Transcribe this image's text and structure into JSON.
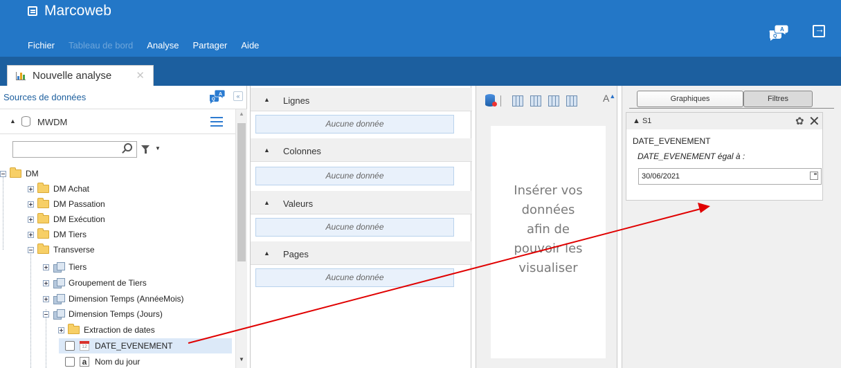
{
  "app": {
    "title": "Marcoweb",
    "menu": [
      {
        "label": "Fichier",
        "enabled": true
      },
      {
        "label": "Tableau de bord",
        "enabled": false
      },
      {
        "label": "Analyse",
        "enabled": true
      },
      {
        "label": "Partager",
        "enabled": true
      },
      {
        "label": "Aide",
        "enabled": true
      }
    ],
    "colors": {
      "header": "#2377c7",
      "tabstrip": "#1c5f9f",
      "annotation_arrow": "#e00000"
    }
  },
  "tab": {
    "label": "Nouvelle analyse",
    "close_icon": "close-icon"
  },
  "sources": {
    "title": "Sources de données",
    "datasource": "MWDM",
    "search": {
      "value": "",
      "placeholder": ""
    },
    "tree": [
      {
        "label": "DM",
        "depth": 0,
        "expander": "minus",
        "icon": "folder-icon"
      },
      {
        "label": "DM Achat",
        "depth": 1,
        "expander": "plus",
        "icon": "folder-icon"
      },
      {
        "label": "DM Passation",
        "depth": 1,
        "expander": "plus",
        "icon": "folder-icon"
      },
      {
        "label": "DM Exécution",
        "depth": 1,
        "expander": "plus",
        "icon": "folder-icon"
      },
      {
        "label": "DM Tiers",
        "depth": 1,
        "expander": "plus",
        "icon": "folder-icon"
      },
      {
        "label": "Transverse",
        "depth": 1,
        "expander": "minus",
        "icon": "folder-icon"
      },
      {
        "label": "Tiers",
        "depth": 2,
        "expander": "plus",
        "icon": "dimension-icon"
      },
      {
        "label": "Groupement de Tiers",
        "depth": 2,
        "expander": "plus",
        "icon": "dimension-icon"
      },
      {
        "label": "Dimension Temps (AnnéeMois)",
        "depth": 2,
        "expander": "plus",
        "icon": "dimension-icon"
      },
      {
        "label": "Dimension Temps (Jours)",
        "depth": 2,
        "expander": "minus",
        "icon": "dimension-icon"
      },
      {
        "label": "Extraction de dates",
        "depth": 3,
        "expander": "plus",
        "icon": "folder-icon"
      },
      {
        "label": "DATE_EVENEMENT",
        "depth": 3,
        "expander": "checkbox",
        "icon": "calendar-icon",
        "selected": true
      },
      {
        "label": "Nom du jour",
        "depth": 3,
        "expander": "checkbox",
        "icon": "text-field-icon"
      }
    ]
  },
  "layout_sections": [
    {
      "label": "Lignes",
      "drop_text": "Aucune donnée"
    },
    {
      "label": "Colonnes",
      "drop_text": "Aucune donnée"
    },
    {
      "label": "Valeurs",
      "drop_text": "Aucune donnée"
    },
    {
      "label": "Pages",
      "drop_text": "Aucune donnée"
    }
  ],
  "visual": {
    "placeholder_lines": [
      "Insérer vos",
      "données",
      "afin de",
      "pouvoir les",
      "visualiser"
    ],
    "toolbar_icons": [
      "database-icon",
      "table-view-icon",
      "chart-table-icon",
      "pivot-icon",
      "grid-icon",
      "font-size-icon"
    ],
    "font_icon_label": "A"
  },
  "filters_panel": {
    "tabs": [
      {
        "label": "Graphiques",
        "active": false
      },
      {
        "label": "Filtres",
        "active": true
      }
    ],
    "section": "S1",
    "field": "DATE_EVENEMENT",
    "condition": "DATE_EVENEMENT égal à :",
    "value": "30/06/2021"
  }
}
